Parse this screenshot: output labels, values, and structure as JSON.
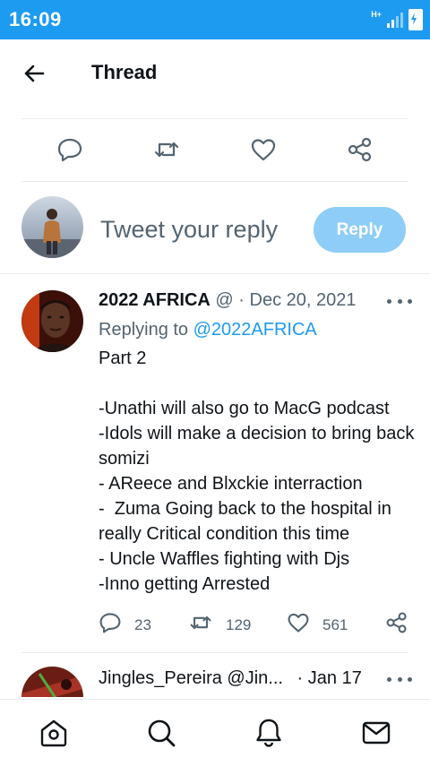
{
  "status_bar": {
    "time": "16:09",
    "network": "H+"
  },
  "header": {
    "title": "Thread"
  },
  "compose": {
    "placeholder": "Tweet your reply",
    "reply_label": "Reply"
  },
  "tweet": {
    "display_name": "2022 AFRICA",
    "handle_trunc": "@",
    "separator": "·",
    "date": "Dec 20, 2021",
    "replying_prefix": "Replying to",
    "replying_handle": "@2022AFRICA",
    "body": "Part 2\n\n-Unathi will also go to MacG podcast\n-Idols will make a decision to bring back somizi\n- AReece and Blxckie interraction\n-  Zuma Going back to the hospital in really Critical condition this time\n- Uncle Waffles fighting with Djs\n-Inno getting Arrested",
    "replies": "23",
    "retweets": "129",
    "likes": "561"
  },
  "tweet2": {
    "display_name": "Jingles_Pereira",
    "handle": "@Jin...",
    "separator": "·",
    "date": "Jan 17"
  },
  "colors": {
    "accent": "#1d9bf0",
    "reply_button": "#8ecdf7",
    "muted": "#536471"
  },
  "icons": [
    "back-arrow-icon",
    "reply-icon",
    "retweet-icon",
    "like-icon",
    "share-icon",
    "more-icon",
    "home-icon",
    "search-icon",
    "notifications-icon",
    "messages-icon"
  ]
}
